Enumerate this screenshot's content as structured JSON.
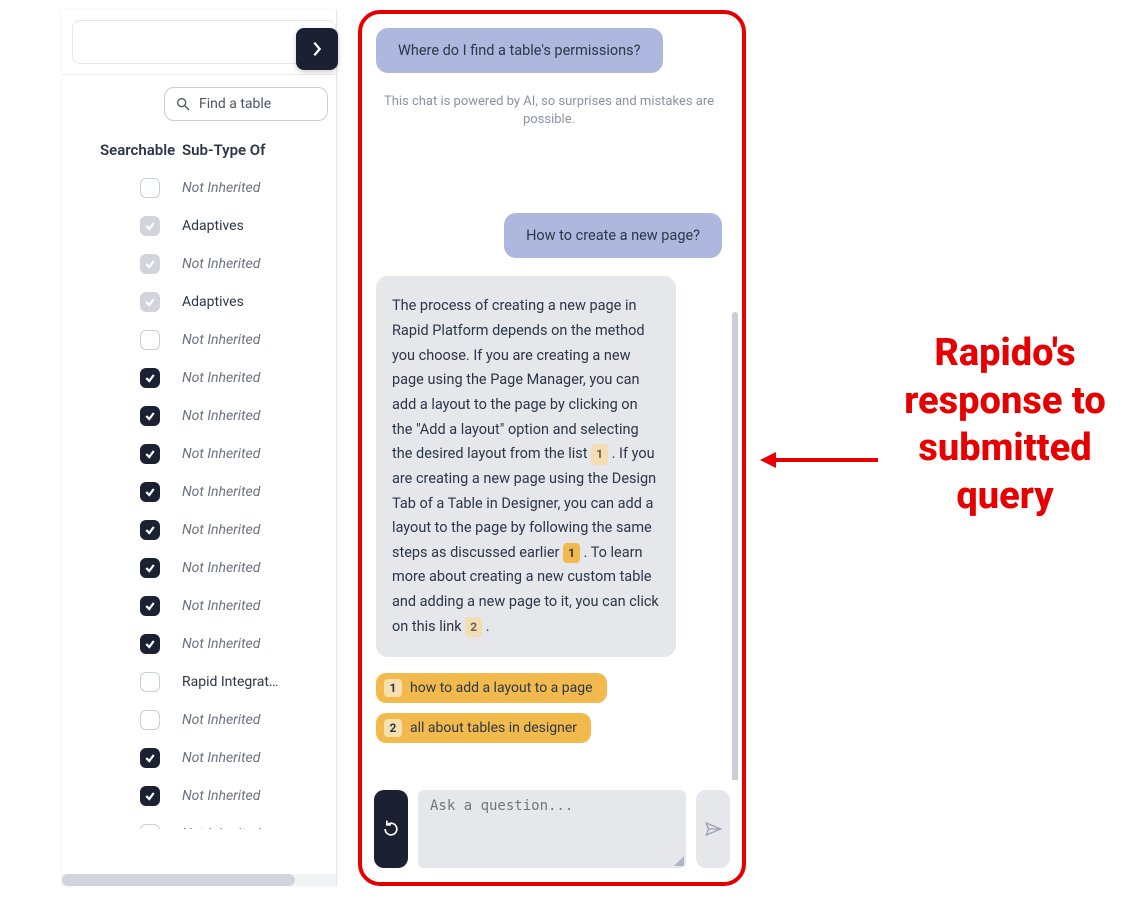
{
  "leftPanel": {
    "searchPlaceholder": "Find a table",
    "headers": {
      "searchable": "Searchable",
      "subtype": "Sub-Type Of"
    },
    "rows": [
      {
        "checkStyle": "empty",
        "checked": false,
        "label": "Not Inherited",
        "emph": false
      },
      {
        "checkStyle": "muted",
        "checked": true,
        "label": "Adaptives",
        "emph": true
      },
      {
        "checkStyle": "muted",
        "checked": true,
        "label": "Not Inherited",
        "emph": false
      },
      {
        "checkStyle": "muted",
        "checked": true,
        "label": "Adaptives",
        "emph": true
      },
      {
        "checkStyle": "empty",
        "checked": false,
        "label": "Not Inherited",
        "emph": false
      },
      {
        "checkStyle": "dark",
        "checked": true,
        "label": "Not Inherited",
        "emph": false
      },
      {
        "checkStyle": "dark",
        "checked": true,
        "label": "Not Inherited",
        "emph": false
      },
      {
        "checkStyle": "dark",
        "checked": true,
        "label": "Not Inherited",
        "emph": false
      },
      {
        "checkStyle": "dark",
        "checked": true,
        "label": "Not Inherited",
        "emph": false
      },
      {
        "checkStyle": "dark",
        "checked": true,
        "label": "Not Inherited",
        "emph": false
      },
      {
        "checkStyle": "dark",
        "checked": true,
        "label": "Not Inherited",
        "emph": false
      },
      {
        "checkStyle": "dark",
        "checked": true,
        "label": "Not Inherited",
        "emph": false
      },
      {
        "checkStyle": "dark",
        "checked": true,
        "label": "Not Inherited",
        "emph": false
      },
      {
        "checkStyle": "empty",
        "checked": false,
        "label": "Rapid Integrat…",
        "emph": true
      },
      {
        "checkStyle": "empty",
        "checked": false,
        "label": "Not Inherited",
        "emph": false
      },
      {
        "checkStyle": "dark",
        "checked": true,
        "label": "Not Inherited",
        "emph": false
      },
      {
        "checkStyle": "dark",
        "checked": true,
        "label": "Not Inherited",
        "emph": false
      },
      {
        "checkStyle": "empty",
        "checked": false,
        "label": "Not Inherited",
        "emph": false
      }
    ]
  },
  "chat": {
    "suggestion": "Where do I find a table's permissions?",
    "disclaimer": "This chat is powered by AI, so surprises and mistakes are possible.",
    "userMsg": "How to create a new page?",
    "aiMsg": {
      "part1": "The process of creating a new page in Rapid Platform depends on the method you choose. If you are creating a new page using the Page Manager, you can add a layout to the page by clicking on the \"Add a layout\" option and selecting the desired layout from the list ",
      "ref1": "1",
      "part2": ". If you are creating a new page using the Design Tab of a Table in Designer, you can add a layout to the page by following the same steps as discussed earlier ",
      "ref2": "1",
      "part3": ". To learn more about creating a new custom table and adding a new page to it, you can click on this link ",
      "ref3": "2",
      "part4": "."
    },
    "refs": [
      {
        "n": "1",
        "label": "how to add a layout to a page"
      },
      {
        "n": "2",
        "label": "all about tables in designer"
      }
    ],
    "inputPlaceholder": "Ask a question..."
  },
  "annotation": "Rapido's response to submitted query"
}
